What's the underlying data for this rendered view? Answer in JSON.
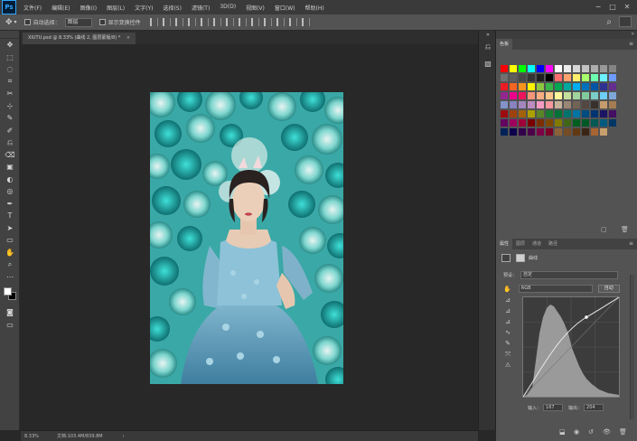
{
  "app": {
    "logo": "Ps"
  },
  "menu": [
    "文件(F)",
    "编辑(E)",
    "图像(I)",
    "图层(L)",
    "文字(Y)",
    "选择(S)",
    "滤镜(T)",
    "3D(D)",
    "视图(V)",
    "窗口(W)",
    "帮助(H)"
  ],
  "window_controls": [
    "−",
    "□",
    "✕"
  ],
  "options_bar": {
    "move_icon": "✥",
    "auto_select_label": "自动选择：",
    "auto_select_value": "图层",
    "show_transform_label": "显示变换控件"
  },
  "document_tab": {
    "title": "XIUTU.psd @ 8.33% (曲线 2, 图层蒙版/8) *",
    "close": "×"
  },
  "status": {
    "zoom": "8.33%",
    "doc": "文档:103.4M/839.8M",
    "arrow": "›"
  },
  "tools": [
    "✥",
    "⬚",
    "◌",
    "⌗",
    "✂",
    "⊹",
    "✎",
    "✐",
    "⎌",
    "⌫",
    "▣",
    "◐",
    "◎",
    "✒",
    "T",
    "➤",
    "▭",
    "✋",
    "⌕",
    "⋯"
  ],
  "swatches_panel": {
    "tab": "色板",
    "colors": [
      [
        "#ff0000",
        "#ffff00",
        "#00ff00",
        "#00ffff",
        "#0000ff",
        "#ff00ff",
        "#ffffff",
        "#ebebeb",
        "#d6d6d6",
        "#c2c2c2",
        "#adadad",
        "#999999",
        "#858585"
      ],
      [
        "#707070",
        "#5c5c5c",
        "#474747",
        "#333333",
        "#1f1f1f",
        "#000000",
        "#ff6d6d",
        "#ffa36d",
        "#ffee6d",
        "#a8ff6d",
        "#6dffb0",
        "#6df0ff",
        "#6d9bff"
      ],
      [
        "#ed1c24",
        "#f26522",
        "#f7941d",
        "#fff200",
        "#8dc63f",
        "#39b54a",
        "#00a651",
        "#00a99d",
        "#00aeef",
        "#0072bc",
        "#0054a6",
        "#2e3192",
        "#662d91"
      ],
      [
        "#92278f",
        "#ec008c",
        "#ed145b",
        "#f69679",
        "#f9ad81",
        "#fdc68a",
        "#fff79a",
        "#c4df9b",
        "#a3d39c",
        "#82ca9d",
        "#7bcdc8",
        "#6ecff6",
        "#7da7d9"
      ],
      [
        "#8393ca",
        "#8882be",
        "#a187be",
        "#bc8cbf",
        "#f49ac2",
        "#f6989d",
        "#c7b299",
        "#998675",
        "#736357",
        "#534741",
        "#37302d",
        "#c69c6d",
        "#a67c52"
      ],
      [
        "#9e0b0f",
        "#a0410d",
        "#a3620a",
        "#aba000",
        "#598527",
        "#197b30",
        "#007236",
        "#00746b",
        "#0076a3",
        "#004b80",
        "#003471",
        "#1b1464",
        "#440e62"
      ],
      [
        "#630460",
        "#9e005d",
        "#9e0039",
        "#790000",
        "#7b2e00",
        "#7d4900",
        "#827b00",
        "#406618",
        "#005e20",
        "#005826",
        "#005952",
        "#005b7f",
        "#003663"
      ],
      [
        "#002157",
        "#0d004c",
        "#32004b",
        "#4b0049",
        "#7b0046",
        "#7a0026",
        "#8c6239",
        "#754c24",
        "#603913",
        "#3c2415",
        "#a86432",
        "#c8a06e"
      ]
    ]
  },
  "props_panel": {
    "tabs": [
      "属性",
      "图层",
      "通道",
      "路径"
    ],
    "title": "曲线",
    "preset_label": "预设：",
    "preset_value": "自定",
    "channel_value": "RGB",
    "auto_button": "自动",
    "input_label": "输入：",
    "input_value": "167",
    "output_label": "输出：",
    "output_value": "204",
    "tools": [
      "✋",
      "⊿",
      "⊿",
      "⊿",
      "∿",
      "✎",
      "⤧",
      "⚠"
    ]
  },
  "icons": {
    "search": "⌕",
    "panel_menu": "≡",
    "collapse": "»",
    "history": "⎌",
    "brush_panel": "▧"
  }
}
